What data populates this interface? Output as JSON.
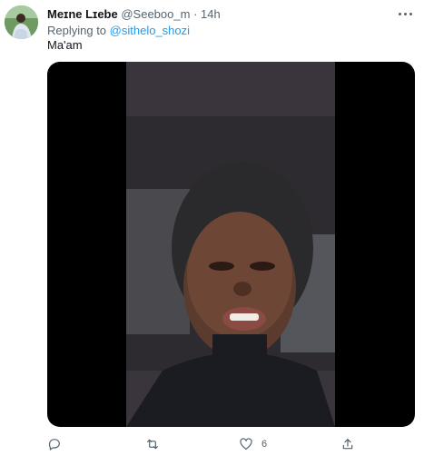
{
  "tweet": {
    "author_name": "Meɪne Lɪebe",
    "handle": "@Seeboo_m",
    "separator": "·",
    "time": "14h",
    "replying_prefix": "Replying to",
    "replying_to": "@sithelo_shozi",
    "text": "Ma'am"
  },
  "actions": {
    "reply_count": "",
    "retweet_count": "",
    "like_count": "6",
    "share_count": ""
  },
  "icons": [
    "more-icon",
    "reply-icon",
    "retweet-icon",
    "like-icon",
    "share-icon"
  ],
  "colors": {
    "text": "#0f1419",
    "secondary": "#536471",
    "link": "#1d9bf0",
    "media_bg": "#000000"
  }
}
